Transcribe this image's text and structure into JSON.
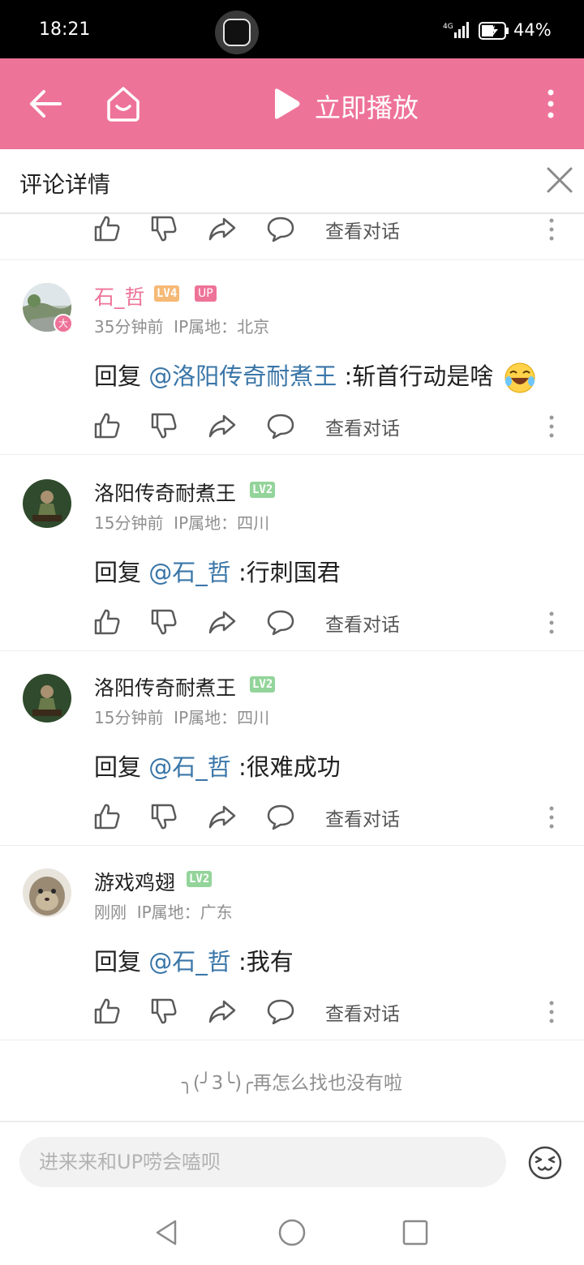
{
  "status_bar": {
    "time": "18:21",
    "network": "4G",
    "battery": "44%"
  },
  "app_bar": {
    "play_label": "立即播放",
    "icons": [
      "back-arrow-icon",
      "home-icon",
      "play-icon",
      "more-vertical-icon"
    ],
    "background": "#ee7398"
  },
  "panel": {
    "title": "评论详情"
  },
  "actions": {
    "view_conversation": "查看对话",
    "icons": [
      "thumbs-up-icon",
      "thumbs-down-icon",
      "share-icon",
      "reply-icon",
      "more-vertical-icon"
    ]
  },
  "comments": [
    {
      "name": "石_哲",
      "level": "LV4",
      "up_tag": "UP",
      "badge": "大",
      "time": "35分钟前",
      "ip": "IP属地：北京",
      "reply_prefix": "回复 ",
      "mention": "@洛阳传奇耐煮王",
      "text": " :斩首行动是啥"
    },
    {
      "name": "洛阳传奇耐煮王",
      "level": "LV2",
      "time": "15分钟前",
      "ip": "IP属地：四川",
      "reply_prefix": "回复 ",
      "mention": "@石_哲",
      "text": " :行刺国君"
    },
    {
      "name": "洛阳传奇耐煮王",
      "level": "LV2",
      "time": "15分钟前",
      "ip": "IP属地：四川",
      "reply_prefix": "回复 ",
      "mention": "@石_哲",
      "text": " :很难成功"
    },
    {
      "name": "游戏鸡翅",
      "level": "LV2",
      "time": "刚刚",
      "ip": "IP属地：广东",
      "reply_prefix": "回复 ",
      "mention": "@石_哲",
      "text": " :我有"
    }
  ],
  "end_tip": "╮(╯3╰)╭再怎么找也没有啦",
  "input": {
    "placeholder": "进来来和UP唠会嗑呗"
  },
  "colors": {
    "accent": "#ee7398",
    "mention": "#3a76a8",
    "meta": "#8f8f8f"
  }
}
